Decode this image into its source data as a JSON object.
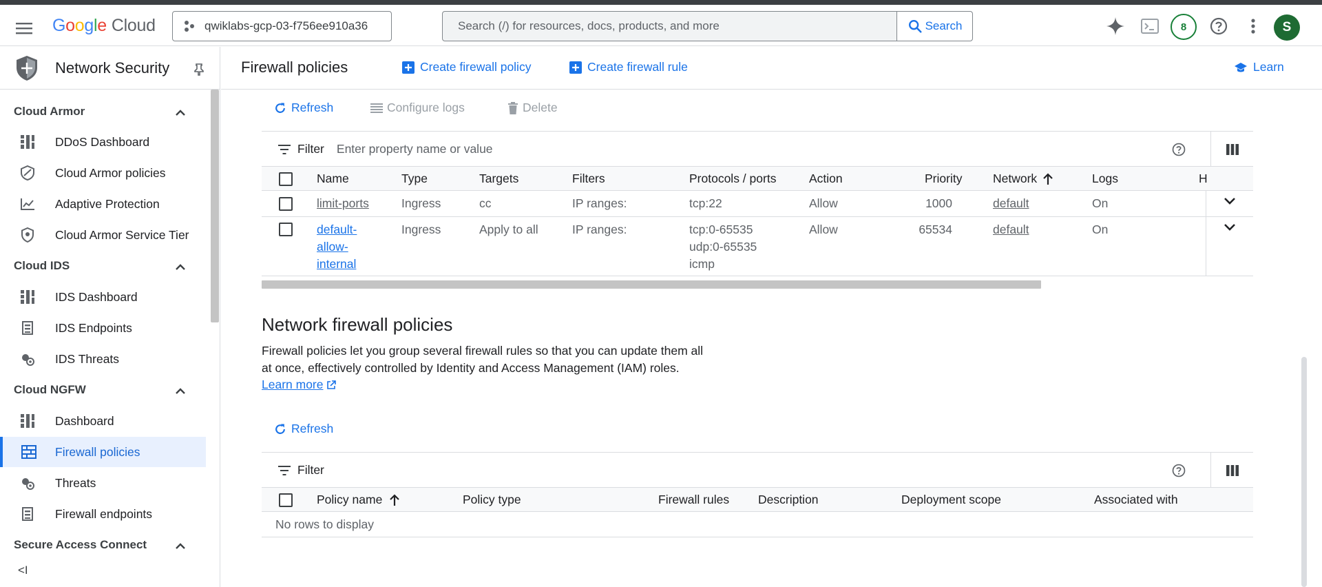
{
  "header": {
    "logo_google": [
      "G",
      "o",
      "o",
      "g",
      "l",
      "e"
    ],
    "logo_cloud": "Cloud",
    "project": "qwiklabs-gcp-03-f756ee910a36",
    "search_placeholder": "Search (/) for resources, docs, products, and more",
    "search_button": "Search",
    "badge_count": "8",
    "avatar_initial": "S"
  },
  "sidebar": {
    "title": "Network Security",
    "sections": [
      {
        "label": "Cloud Armor",
        "items": [
          "DDoS Dashboard",
          "Cloud Armor policies",
          "Adaptive Protection",
          "Cloud Armor Service Tier"
        ]
      },
      {
        "label": "Cloud IDS",
        "items": [
          "IDS Dashboard",
          "IDS Endpoints",
          "IDS Threats"
        ]
      },
      {
        "label": "Cloud NGFW",
        "items": [
          "Dashboard",
          "Firewall policies",
          "Threats",
          "Firewall endpoints"
        ]
      },
      {
        "label": "Secure Access Connect",
        "items": []
      }
    ],
    "active_item": "Firewall policies",
    "collapse_label": "<I"
  },
  "page": {
    "title": "Firewall policies",
    "create_policy": "Create firewall policy",
    "create_rule": "Create firewall rule",
    "learn": "Learn"
  },
  "rules_toolbar": {
    "refresh": "Refresh",
    "configure_logs": "Configure logs",
    "delete": "Delete"
  },
  "rules_filter": {
    "label": "Filter",
    "placeholder": "Enter property name or value"
  },
  "rules_table": {
    "columns": [
      "Name",
      "Type",
      "Targets",
      "Filters",
      "Protocols / ports",
      "Action",
      "Priority",
      "Network",
      "Logs",
      "H"
    ],
    "rows": [
      {
        "name": [
          "limit-ports"
        ],
        "type": "Ingress",
        "targets": "cc",
        "filters": "IP ranges:",
        "protocols": [
          "tcp:22"
        ],
        "action": "Allow",
        "priority": "1000",
        "network": "default",
        "logs": "On"
      },
      {
        "name": [
          "default-",
          "allow-",
          "internal"
        ],
        "type": "Ingress",
        "targets": "Apply to all",
        "filters": "IP ranges:",
        "protocols": [
          "tcp:0-65535",
          "udp:0-65535",
          "icmp"
        ],
        "action": "Allow",
        "priority": "65534",
        "network": "default",
        "logs": "On"
      }
    ]
  },
  "network_policies": {
    "title": "Network firewall policies",
    "description": "Firewall policies let you group several firewall rules so that you can update them all at once, effectively controlled by Identity and Access Management (IAM) roles.",
    "learn_more": "Learn more",
    "refresh": "Refresh",
    "filter_label": "Filter",
    "columns": [
      "Policy name",
      "Policy type",
      "Firewall rules",
      "Description",
      "Deployment scope",
      "Associated with"
    ],
    "empty_text": "No rows to display"
  },
  "colors": {
    "accent": "#1a73e8",
    "active_bg": "#e8f0fe",
    "badge": "#188038",
    "avatar": "#1e6b33"
  }
}
